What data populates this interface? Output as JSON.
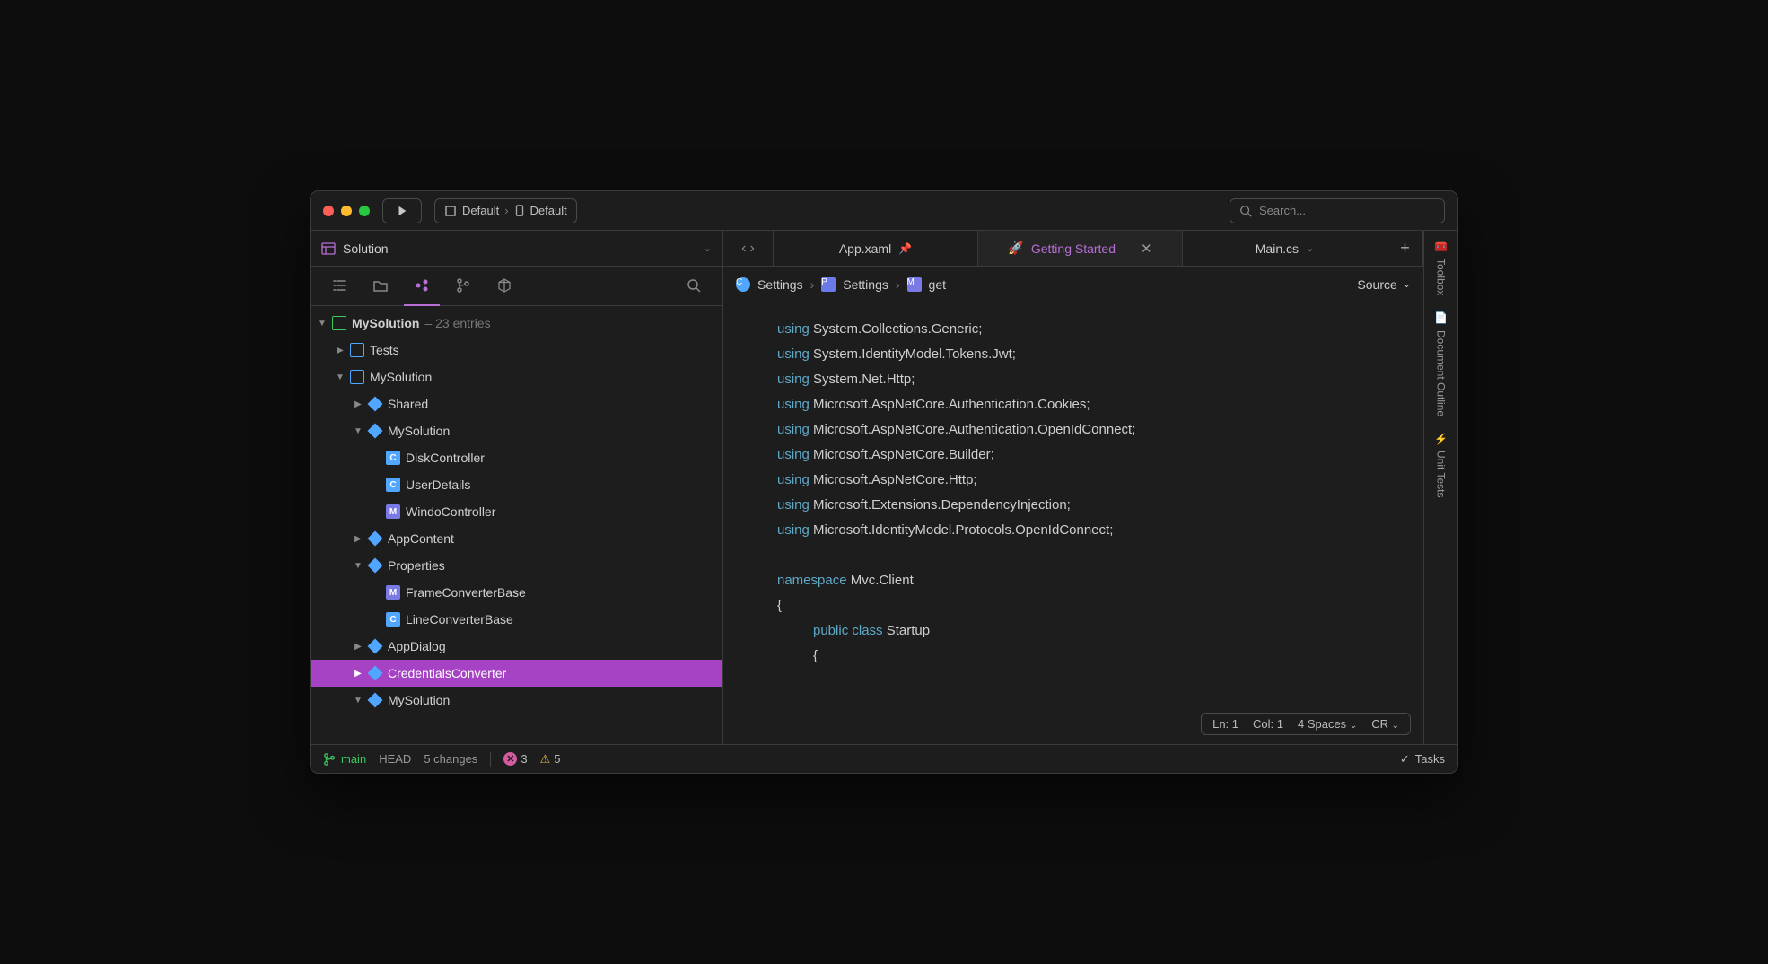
{
  "titlebar": {
    "config_scheme": "Default",
    "config_target": "Default",
    "search_placeholder": "Search..."
  },
  "sidebar": {
    "header": "Solution",
    "root": {
      "name": "MySolution",
      "meta": "– 23 entries"
    },
    "items": [
      {
        "name": "Tests",
        "depth": 1,
        "chev": "▶",
        "icon": "blue-sq"
      },
      {
        "name": "MySolution",
        "depth": 1,
        "chev": "▼",
        "icon": "blue-sq"
      },
      {
        "name": "Shared",
        "depth": 2,
        "chev": "▶",
        "icon": "diamond"
      },
      {
        "name": "MySolution",
        "depth": 2,
        "chev": "▼",
        "icon": "diamond"
      },
      {
        "name": "DiskController",
        "depth": 3,
        "chev": "",
        "icon": "cs"
      },
      {
        "name": "UserDetails",
        "depth": 3,
        "chev": "",
        "icon": "cs"
      },
      {
        "name": "WindoController",
        "depth": 3,
        "chev": "",
        "icon": "m"
      },
      {
        "name": "AppContent",
        "depth": 2,
        "chev": "▶",
        "icon": "diamond"
      },
      {
        "name": "Properties",
        "depth": 2,
        "chev": "▼",
        "icon": "diamond"
      },
      {
        "name": "FrameConverterBase",
        "depth": 3,
        "chev": "",
        "icon": "m"
      },
      {
        "name": "LineConverterBase",
        "depth": 3,
        "chev": "",
        "icon": "cs"
      },
      {
        "name": "AppDialog",
        "depth": 2,
        "chev": "▶",
        "icon": "diamond"
      },
      {
        "name": "CredentialsConverter",
        "depth": 2,
        "chev": "▶",
        "icon": "diamond",
        "selected": true
      },
      {
        "name": "MySolution",
        "depth": 2,
        "chev": "▼",
        "icon": "diamond"
      }
    ]
  },
  "tabs": [
    {
      "label": "App.xaml",
      "pinned": true
    },
    {
      "label": "Getting Started",
      "active": true,
      "rocket": true,
      "closable": true
    },
    {
      "label": "Main.cs",
      "dropdown": true
    }
  ],
  "breadcrumb": {
    "a": "Settings",
    "b": "Settings",
    "c": "get",
    "source_label": "Source"
  },
  "code": {
    "lines": [
      {
        "k": "using",
        "t": "System.Collections.Generic;"
      },
      {
        "k": "using",
        "t": "System.IdentityModel.Tokens.Jwt;"
      },
      {
        "k": "using",
        "t": "System.Net.Http;"
      },
      {
        "k": "using",
        "t": "Microsoft.AspNetCore.Authentication.Cookies;"
      },
      {
        "k": "using",
        "t": "Microsoft.AspNetCore.Authentication.OpenIdConnect;"
      },
      {
        "k": "using",
        "t": "Microsoft.AspNetCore.Builder;"
      },
      {
        "k": "using",
        "t": "Microsoft.AspNetCore.Http;"
      },
      {
        "k": "using",
        "t": "Microsoft.Extensions.DependencyInjection;"
      },
      {
        "k": "using",
        "t": "Microsoft.IdentityModel.Protocols.OpenIdConnect;"
      }
    ],
    "ns_kw": "namespace",
    "ns_name": "Mvc.Client",
    "brace_open": "{",
    "pub": "public",
    "cls": "class",
    "cls_name": "Startup",
    "brace_open2": "{"
  },
  "editor_status": {
    "ln": "Ln: 1",
    "col": "Col: 1",
    "indent": "4 Spaces",
    "ending": "CR"
  },
  "right_rail": {
    "a": "Toolbox",
    "b": "Document Outline",
    "c": "Unit Tests"
  },
  "statusbar": {
    "branch": "main",
    "head": "HEAD",
    "changes": "5 changes",
    "errors": "3",
    "warnings": "5",
    "tasks": "Tasks"
  }
}
